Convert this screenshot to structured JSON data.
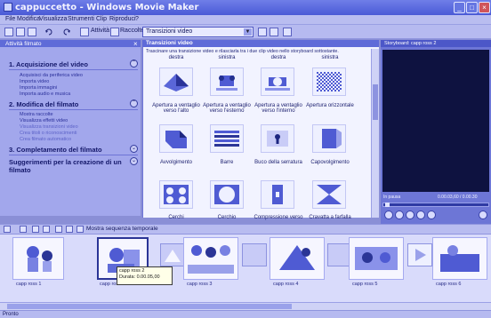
{
  "window": {
    "title": "cappuccetto - Windows Movie Maker",
    "minimize": "_",
    "maximize": "□",
    "close": "×"
  },
  "menu": [
    "File",
    "Modifica",
    "Visualizza",
    "Strumenti",
    "Clip",
    "Riproduci",
    "?"
  ],
  "toolbar": {
    "tasks_label": "Attività",
    "collections_label": "Raccolte",
    "collection_value": "Transizioni video",
    "icons": [
      "new-icon",
      "open-icon",
      "save-icon",
      "undo-icon",
      "redo-icon",
      "tasks-icon",
      "collections-icon",
      "up-folder-icon",
      "new-folder-icon",
      "views-icon"
    ]
  },
  "taskpane": {
    "header": "Attività filmato",
    "close": "×",
    "sections": [
      {
        "title": "1. Acquisizione del video",
        "toggle": "⌃",
        "links": [
          "Acquisisci da periferica video",
          "Importa video",
          "Importa immagini",
          "Importa audio e musica"
        ]
      },
      {
        "title": "2. Modifica del filmato",
        "toggle": "⌃",
        "links": [
          "Mostra raccolte",
          "Visualizza effetti video",
          "Visualizza transizioni video",
          "Crea titoli o riconoscimenti",
          "Crea filmato automatico"
        ]
      },
      {
        "title": "3. Completamento del filmato",
        "toggle": "⌄",
        "links": []
      },
      {
        "title": "Suggerimenti per la creazione di un filmato",
        "toggle": "⌄",
        "links": []
      }
    ]
  },
  "content": {
    "header": "Transizioni video",
    "instructions": "Trascinare una transizione video e rilasciarla tra i due clip video nello storyboard sottostante.",
    "top_row_labels": [
      "destra",
      "sinistra",
      "destra",
      "sinistra"
    ],
    "items": [
      "Apertura a ventaglio verso l'alto",
      "Apertura a ventaglio verso l'esterno",
      "Apertura a ventaglio verso l'interno",
      "Apertura orizzontale",
      "Avvolgimento",
      "Barre",
      "Buco della serratura",
      "Capovolgimento",
      "Cerchi",
      "Cerchio",
      "Compressione verso",
      "Cravatta a farfalla"
    ]
  },
  "monitor": {
    "header": "Storyboard: capp ross 2",
    "status": "In pausa",
    "time": "0.00.03,60 / 0.00.30"
  },
  "storyboard": {
    "tool_label": "Mostra sequenza temporale",
    "clips": [
      "capp ross 1",
      "capp ross 2",
      "capp ross 3",
      "capp ross 4",
      "capp ross 5",
      "capp ross 6"
    ],
    "tooltip": {
      "name": "capp ross 2",
      "duration": "Durata: 0.00.05,00"
    }
  },
  "statusbar": {
    "text": "Pronto"
  },
  "colors": {
    "accent": "#5f6bd8",
    "background": "#8a8fd6",
    "pane": "#f2f3ff"
  }
}
